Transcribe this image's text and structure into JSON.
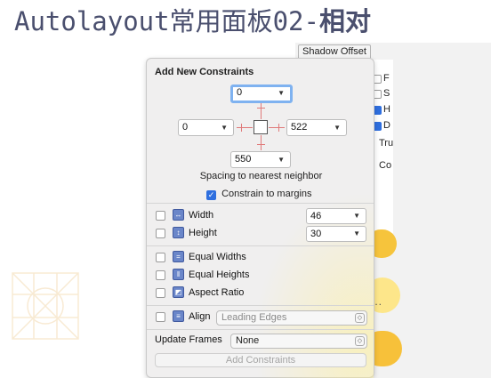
{
  "page": {
    "title_regular": "Autolayout常用面板02-",
    "title_bold": "相对"
  },
  "background": {
    "shadow_offset_label": "Shadow Offset",
    "right_items": [
      "F",
      "S",
      "H",
      "D",
      "Tru",
      "Co"
    ],
    "dots": "..."
  },
  "popover": {
    "title": "Add New Constraints",
    "top_value": "0",
    "left_value": "0",
    "right_value": "522",
    "bottom_value": "550",
    "spacing_label": "Spacing to nearest neighbor",
    "constrain_margins_label": "Constrain to margins",
    "constrain_margins_checked": true,
    "width_label": "Width",
    "width_value": "46",
    "height_label": "Height",
    "height_value": "30",
    "equal_widths_label": "Equal Widths",
    "equal_heights_label": "Equal Heights",
    "aspect_ratio_label": "Aspect Ratio",
    "align_label": "Align",
    "align_value": "Leading Edges",
    "update_frames_label": "Update Frames",
    "update_frames_value": "None",
    "add_constraints_label": "Add Constraints"
  },
  "colors": {
    "accent": "#2f6fdf",
    "strut": "#e07a7a",
    "title": "#4a4f6e"
  }
}
